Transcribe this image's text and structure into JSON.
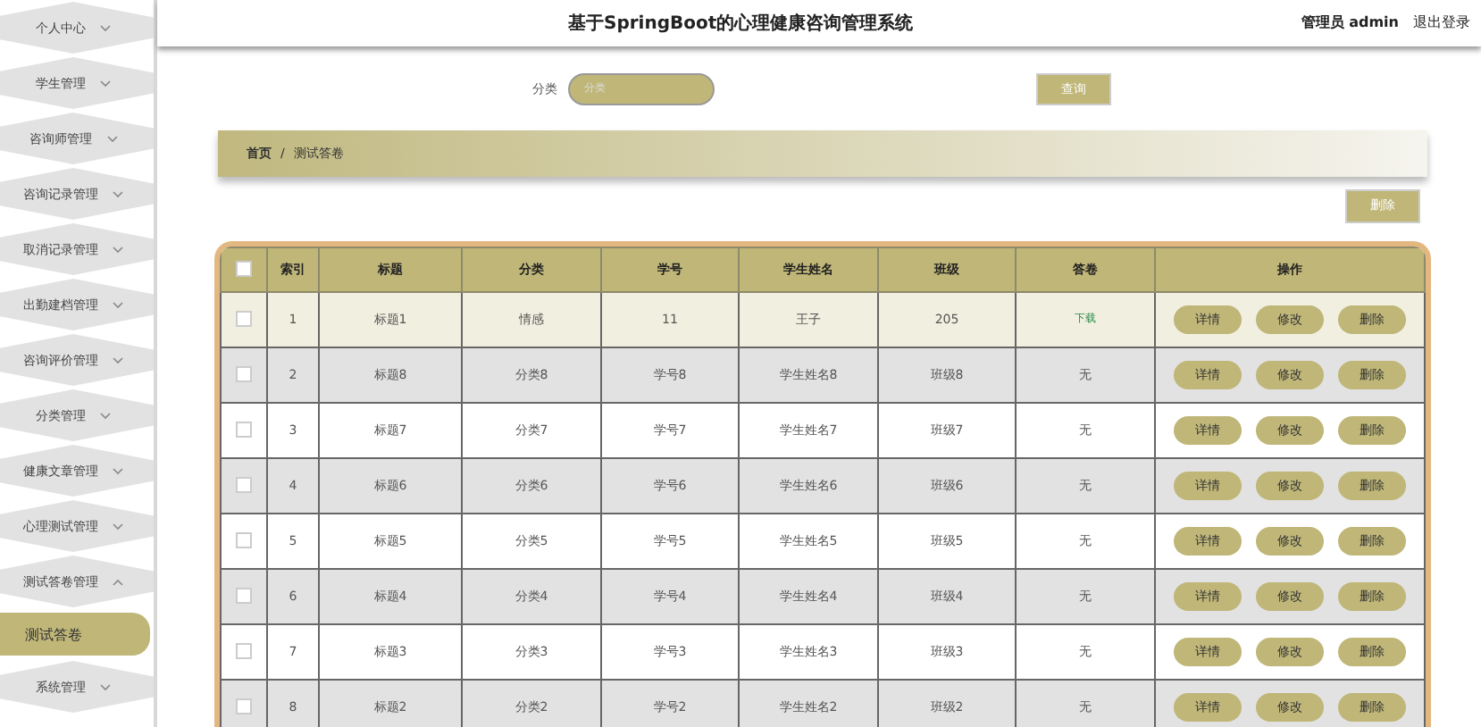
{
  "sidebar": {
    "items": [
      {
        "label": "个人中心",
        "expanded": false
      },
      {
        "label": "学生管理",
        "expanded": false
      },
      {
        "label": "咨询师管理",
        "expanded": false
      },
      {
        "label": "咨询记录管理",
        "expanded": false
      },
      {
        "label": "取消记录管理",
        "expanded": false
      },
      {
        "label": "出勤建档管理",
        "expanded": false
      },
      {
        "label": "咨询评价管理",
        "expanded": false
      },
      {
        "label": "分类管理",
        "expanded": false
      },
      {
        "label": "健康文章管理",
        "expanded": false
      },
      {
        "label": "心理测试管理",
        "expanded": false
      },
      {
        "label": "测试答卷管理",
        "expanded": true,
        "children": [
          {
            "label": "测试答卷",
            "selected": true
          }
        ]
      },
      {
        "label": "系统管理",
        "expanded": false
      }
    ]
  },
  "header": {
    "title": "基于SpringBoot的心理健康咨询管理系统",
    "user": "管理员 admin",
    "logout": "退出登录"
  },
  "search": {
    "label": "分类",
    "placeholder": "分类",
    "button": "查询"
  },
  "breadcrumb": {
    "separator": "/",
    "items": [
      "首页",
      "测试答卷"
    ]
  },
  "select_all": {
    "checked": false
  },
  "delete_button": "删除",
  "table": {
    "columns": [
      "索引",
      "标题",
      "分类",
      "学号",
      "学生姓名",
      "班级",
      "答卷",
      "操作"
    ],
    "rows": [
      {
        "checked": false,
        "highlighted": true,
        "cells": [
          "1",
          "标题1",
          "情感",
          "11",
          "王子",
          "205"
        ],
        "answer": {
          "kind": "link",
          "text": "下载"
        },
        "actions": [
          "详情",
          "修改",
          "删除"
        ]
      },
      {
        "checked": false,
        "highlighted": false,
        "cells": [
          "2",
          "标题8",
          "分类8",
          "学号8",
          "学生姓名8",
          "班级8"
        ],
        "answer": {
          "kind": "text",
          "text": "无"
        },
        "actions": [
          "详情",
          "修改",
          "删除"
        ]
      },
      {
        "checked": false,
        "highlighted": false,
        "cells": [
          "3",
          "标题7",
          "分类7",
          "学号7",
          "学生姓名7",
          "班级7"
        ],
        "answer": {
          "kind": "text",
          "text": "无"
        },
        "actions": [
          "详情",
          "修改",
          "删除"
        ]
      },
      {
        "checked": false,
        "highlighted": false,
        "cells": [
          "4",
          "标题6",
          "分类6",
          "学号6",
          "学生姓名6",
          "班级6"
        ],
        "answer": {
          "kind": "text",
          "text": "无"
        },
        "actions": [
          "详情",
          "修改",
          "删除"
        ]
      },
      {
        "checked": false,
        "highlighted": false,
        "cells": [
          "5",
          "标题5",
          "分类5",
          "学号5",
          "学生姓名5",
          "班级5"
        ],
        "answer": {
          "kind": "text",
          "text": "无"
        },
        "actions": [
          "详情",
          "修改",
          "删除"
        ]
      },
      {
        "checked": false,
        "highlighted": false,
        "cells": [
          "6",
          "标题4",
          "分类4",
          "学号4",
          "学生姓名4",
          "班级4"
        ],
        "answer": {
          "kind": "text",
          "text": "无"
        },
        "actions": [
          "详情",
          "修改",
          "删除"
        ]
      },
      {
        "checked": false,
        "highlighted": false,
        "cells": [
          "7",
          "标题3",
          "分类3",
          "学号3",
          "学生姓名3",
          "班级3"
        ],
        "answer": {
          "kind": "text",
          "text": "无"
        },
        "actions": [
          "详情",
          "修改",
          "删除"
        ]
      },
      {
        "checked": false,
        "highlighted": false,
        "cells": [
          "8",
          "标题2",
          "分类2",
          "学号2",
          "学生姓名2",
          "班级2"
        ],
        "answer": {
          "kind": "text",
          "text": "无"
        },
        "actions": [
          "详情",
          "修改",
          "删除"
        ]
      }
    ]
  }
}
